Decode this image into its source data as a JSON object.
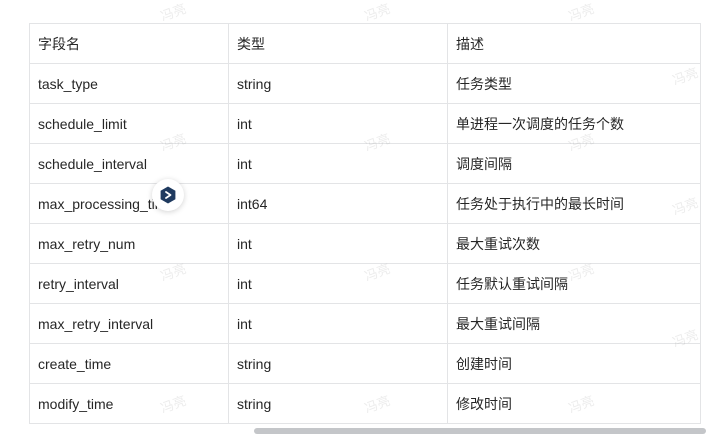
{
  "table": {
    "headers": [
      "字段名",
      "类型",
      "描述"
    ],
    "rows": [
      [
        "task_type",
        "string",
        "任务类型"
      ],
      [
        "schedule_limit",
        "int",
        "单进程一次调度的任务个数"
      ],
      [
        "schedule_interval",
        "int",
        "调度间隔"
      ],
      [
        "max_processing_time",
        "int64",
        "任务处于执行中的最长时间"
      ],
      [
        "max_retry_num",
        "int",
        "最大重试次数"
      ],
      [
        "retry_interval",
        "int",
        "任务默认重试间隔"
      ],
      [
        "max_retry_interval",
        "int",
        "最大重试间隔"
      ],
      [
        "create_time",
        "string",
        "创建时间"
      ],
      [
        "modify_time",
        "string",
        "修改时间"
      ]
    ]
  },
  "watermark": {
    "text": "冯亮"
  },
  "floating_badge": {
    "icon": "assistant-hexagon-icon",
    "color": "#1f3a5f"
  },
  "colors": {
    "border": "#e3e4e6",
    "text": "#262626",
    "scrollbar": "#c4c6c9"
  }
}
